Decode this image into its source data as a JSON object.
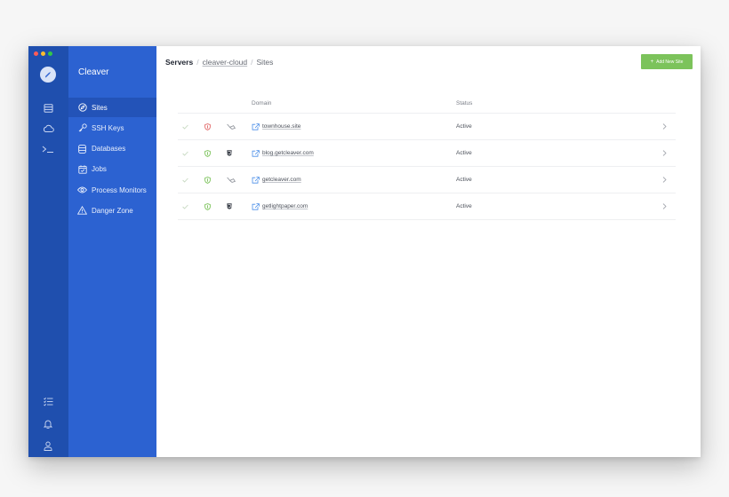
{
  "app": {
    "name": "Cleaver"
  },
  "colors": {
    "rail_bg": "#1f4fae",
    "nav_bg": "#2c62d1",
    "nav_active_bg": "#2353b8",
    "accent_green": "#7cc35b",
    "shield_red": "#e26a6a",
    "shield_green": "#7cc35b",
    "link_blue": "#4a8ee8"
  },
  "rail": {
    "top_icons": [
      "servers-icon",
      "cloud-icon",
      "terminal-icon"
    ],
    "bottom_icons": [
      "checklist-icon",
      "bell-icon",
      "user-icon"
    ]
  },
  "nav": {
    "items": [
      {
        "label": "Sites",
        "icon": "compass-icon",
        "active": true
      },
      {
        "label": "SSH Keys",
        "icon": "key-icon",
        "active": false
      },
      {
        "label": "Databases",
        "icon": "database-icon",
        "active": false
      },
      {
        "label": "Jobs",
        "icon": "calendar-icon",
        "active": false
      },
      {
        "label": "Process Monitors",
        "icon": "eye-icon",
        "active": false
      },
      {
        "label": "Danger Zone",
        "icon": "warning-icon",
        "active": false
      }
    ]
  },
  "breadcrumb": {
    "root": "Servers",
    "server": "cleaver-cloud",
    "current": "Sites",
    "separator": "/"
  },
  "toolbar": {
    "add_label": "Add New Site",
    "add_prefix": "+"
  },
  "table": {
    "columns": {
      "domain": "Domain",
      "status": "Status"
    },
    "rows": [
      {
        "domain": "townhouse.site",
        "status": "Active",
        "ssl": "insecure",
        "type": "trowel"
      },
      {
        "domain": "blog.getcleaver.com",
        "status": "Active",
        "ssl": "secure",
        "type": "html5"
      },
      {
        "domain": "getcleaver.com",
        "status": "Active",
        "ssl": "secure",
        "type": "trowel"
      },
      {
        "domain": "getlightpaper.com",
        "status": "Active",
        "ssl": "secure",
        "type": "html5"
      }
    ]
  }
}
